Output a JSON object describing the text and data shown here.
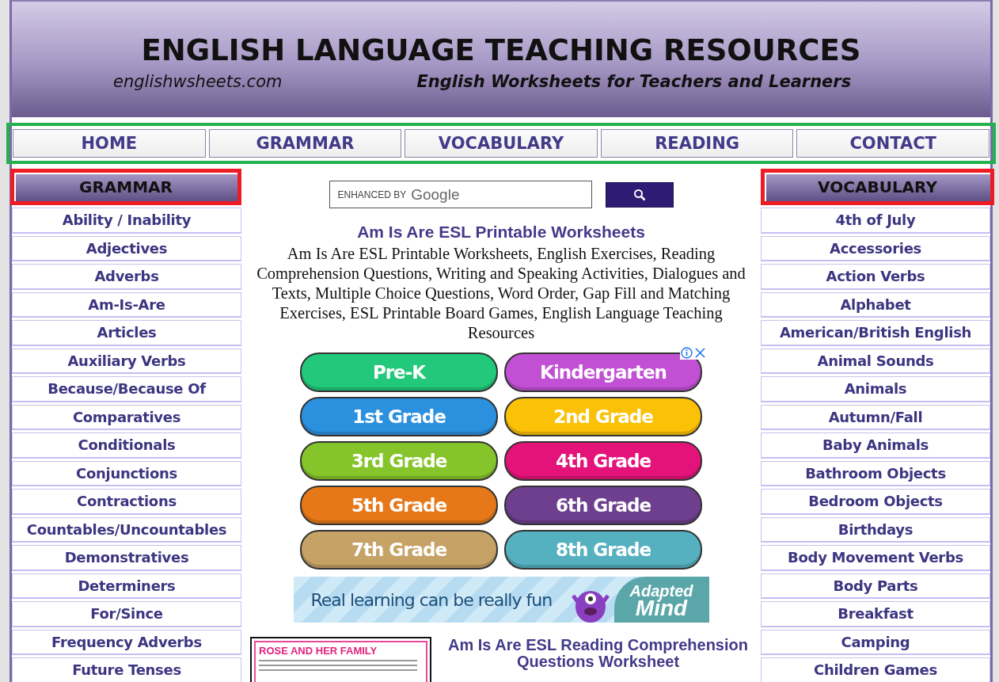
{
  "header": {
    "title": "ENGLISH LANGUAGE TEACHING RESOURCES",
    "site": "englishwsheets.com",
    "tagline": "English Worksheets for Teachers and Learners"
  },
  "nav": {
    "highlighted": true,
    "items": [
      {
        "label": "HOME"
      },
      {
        "label": "GRAMMAR"
      },
      {
        "label": "VOCABULARY"
      },
      {
        "label": "READING"
      },
      {
        "label": "CONTACT"
      }
    ]
  },
  "left_sidebar": {
    "heading": "GRAMMAR",
    "highlighted": true,
    "items": [
      "Ability / Inability",
      "Adjectives",
      "Adverbs",
      "Am-Is-Are",
      "Articles",
      "Auxiliary Verbs",
      "Because/Because Of",
      "Comparatives",
      "Conditionals",
      "Conjunctions",
      "Contractions",
      "Countables/Uncountables",
      "Demonstratives",
      "Determiners",
      "For/Since",
      "Frequency Adverbs",
      "Future Tenses"
    ]
  },
  "right_sidebar": {
    "heading": "VOCABULARY",
    "highlighted": true,
    "items": [
      "4th of July",
      "Accessories",
      "Action Verbs",
      "Alphabet",
      "American/British English",
      "Animal Sounds",
      "Animals",
      "Autumn/Fall",
      "Baby Animals",
      "Bathroom Objects",
      "Bedroom Objects",
      "Birthdays",
      "Body Movement Verbs",
      "Body Parts",
      "Breakfast",
      "Camping",
      "Children Games"
    ]
  },
  "search": {
    "placeholder_prefix": "ENHANCED BY",
    "placeholder_brand": "Google"
  },
  "article": {
    "title": "Am Is Are ESL Printable Worksheets",
    "description": "Am Is Are ESL Printable Worksheets, English Exercises, Reading Comprehension Questions, Writing and Speaking Activities, Dialogues and Texts, Multiple Choice Questions, Word Order, Gap Fill and Matching Exercises, ESL Printable Board Games, English Language Teaching Resources"
  },
  "grade_ad": {
    "buttons": [
      {
        "label": "Pre-K",
        "color": "#22c97a"
      },
      {
        "label": "Kindergarten",
        "color": "#c150d4"
      },
      {
        "label": "1st Grade",
        "color": "#2b90de"
      },
      {
        "label": "2nd Grade",
        "color": "#fac107"
      },
      {
        "label": "3rd Grade",
        "color": "#85c42a"
      },
      {
        "label": "4th Grade",
        "color": "#e3137a"
      },
      {
        "label": "5th Grade",
        "color": "#e67819"
      },
      {
        "label": "6th Grade",
        "color": "#6e3f8e"
      },
      {
        "label": "7th Grade",
        "color": "#c6a266"
      },
      {
        "label": "8th Grade",
        "color": "#55b1c0"
      }
    ]
  },
  "banner": {
    "text": "Real learning can be really fun",
    "logo_top": "Adapted",
    "logo_bottom": "Mind"
  },
  "worksheet": {
    "thumbnail_title": "ROSE AND HER FAMILY",
    "heading": "Am Is Are ESL Reading Comprehension Questions Worksheet"
  }
}
